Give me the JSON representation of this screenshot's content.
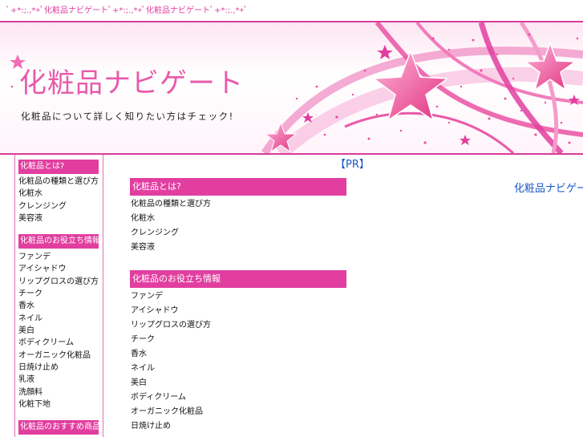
{
  "topbar": {
    "text": "ﾟ+*:;.,*+ﾟ化粧品ナビゲートﾟ+*:;.,*+ﾟ化粧品ナビゲートﾟ+*:;.,*+ﾟ"
  },
  "header": {
    "title": "化粧品ナビゲート",
    "subtitle": "化粧品について詳しく知りたい方はチェック!",
    "colors": {
      "accent": "#e23ea0",
      "title": "#e85aab",
      "link": "#1a57c8"
    }
  },
  "sidebar": {
    "sections": [
      {
        "heading": "化粧品とは?",
        "items": [
          "化粧品の種類と選び方",
          "化粧水",
          "クレンジング",
          "美容液"
        ]
      },
      {
        "heading": "化粧品のお役立ち情報",
        "items": [
          "ファンデ",
          "アイシャドウ",
          "リップグロスの選び方",
          "チーク",
          "香水",
          "ネイル",
          "美白",
          "ボディクリーム",
          "オーガニック化粧品",
          "日焼け止め",
          "乳液",
          "洗顔料",
          "化粧下地"
        ]
      },
      {
        "heading": "化粧品のおすすめ商品",
        "items": []
      }
    ]
  },
  "main": {
    "pr_label": "【PR】",
    "sections": [
      {
        "heading": "化粧品とは?",
        "items": [
          "化粧品の種類と選び方",
          "化粧水",
          "クレンジング",
          "美容液"
        ]
      },
      {
        "heading": "化粧品のお役立ち情報",
        "items": [
          "ファンデ",
          "アイシャドウ",
          "リップグロスの選び方",
          "チーク",
          "香水",
          "ネイル",
          "美白",
          "ボディクリーム",
          "オーガニック化粧品",
          "日焼け止め"
        ]
      }
    ]
  },
  "right": {
    "link_text": "化粧品ナビゲート"
  }
}
